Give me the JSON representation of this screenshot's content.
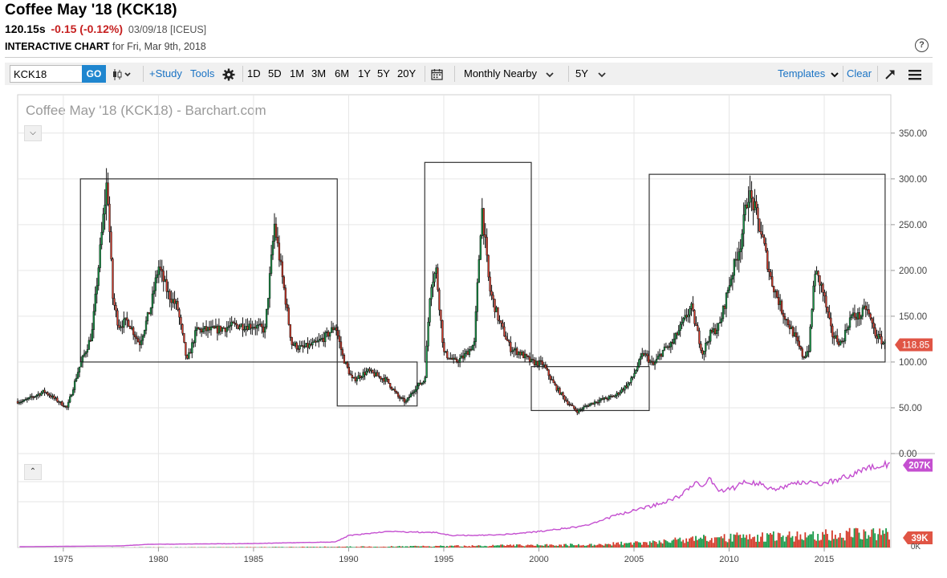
{
  "header": {
    "title": "Coffee May '18 (KCK18)",
    "last": "120.15s",
    "change": "-0.15 (-0.12%)",
    "date_exchange": "03/09/18 [ICEUS]",
    "chart_label": "INTERACTIVE CHART",
    "chart_date": "for Fri, Mar 9th, 2018"
  },
  "toolbar": {
    "symbol_value": "KCK18",
    "go_label": "GO",
    "study_label": "+Study",
    "tools_label": "Tools",
    "periods": [
      "1D",
      "5D",
      "1M",
      "3M",
      "6M",
      "1Y",
      "5Y",
      "20Y"
    ],
    "contract_mode": "Monthly Nearby",
    "range": "5Y",
    "templates_label": "Templates",
    "clear_label": "Clear"
  },
  "icons": {
    "chart_type": "candlestick-icon",
    "settings": "gear-icon",
    "calendar": "calendar-icon",
    "expand": "expand-arrow-icon",
    "menu": "hamburger-menu-icon",
    "help": "help-icon"
  },
  "colors": {
    "up": "#1a9a4a",
    "down": "#d43a2a",
    "open_interest": "#c44fd0",
    "last_price_badge": "#e05545",
    "volume_badge": "#e05545",
    "link": "#1a73c4"
  },
  "chart_data": {
    "type": "candlestick",
    "watermark": "Coffee May '18 (KCK18) - Barchart.com",
    "xlim": [
      1972.6,
      2018.5
    ],
    "ylim": [
      0,
      370
    ],
    "y_ticks": [
      "350.00",
      "300.00",
      "250.00",
      "200.00",
      "150.00",
      "100.00",
      "50.00",
      "0.00"
    ],
    "x_ticks": [
      "1975",
      "1980",
      "1985",
      "1990",
      "1995",
      "2000",
      "2005",
      "2010",
      "2015"
    ],
    "last_price_label": "118.85",
    "series": [
      {
        "name": "price",
        "x": [
          1972.9,
          1974,
          1975.2,
          1975.8,
          1976.5,
          1977.3,
          1977.6,
          1977.9,
          1978.4,
          1979,
          1979.6,
          1980.0,
          1980.5,
          1981,
          1981.5,
          1982,
          1983,
          1984,
          1985,
          1985.6,
          1986.1,
          1986.6,
          1987,
          1987.5,
          1988.3,
          1988.9,
          1989.3,
          1989.7,
          1990.2,
          1991,
          1992,
          1992.6,
          1993,
          1993.5,
          1994,
          1994.3,
          1994.6,
          1995,
          1995.6,
          1996,
          1996.6,
          1997.0,
          1997.4,
          1997.9,
          1998.5,
          1999.0,
          1999.6,
          2000.2,
          2000.8,
          2001.5,
          2002,
          2002.5,
          2003,
          2004,
          2004.8,
          2005.5,
          2006.0,
          2006.5,
          2007,
          2008,
          2008.6,
          2009,
          2009.5,
          2010,
          2010.6,
          2011.0,
          2011.3,
          2011.7,
          2012.2,
          2012.8,
          2013.4,
          2013.9,
          2014.2,
          2014.5,
          2014.9,
          2015.4,
          2015.9,
          2016.4,
          2016.9,
          2017.2,
          2017.7,
          2018.2
        ],
        "y": [
          57,
          68,
          50,
          92,
          130,
          300,
          170,
          140,
          145,
          120,
          160,
          205,
          175,
          160,
          100,
          135,
          135,
          140,
          140,
          135,
          250,
          180,
          120,
          115,
          120,
          130,
          140,
          105,
          80,
          90,
          80,
          62,
          56,
          72,
          80,
          185,
          200,
          110,
          100,
          105,
          120,
          270,
          180,
          145,
          115,
          110,
          100,
          98,
          75,
          56,
          46,
          52,
          57,
          63,
          78,
          110,
          96,
          112,
          120,
          160,
          110,
          130,
          140,
          185,
          230,
          285,
          270,
          240,
          190,
          155,
          130,
          105,
          115,
          200,
          180,
          130,
          120,
          150,
          150,
          160,
          130,
          118.85
        ]
      },
      {
        "name": "open interest",
        "x": [
          1972.7,
          1978,
          1979.5,
          1985,
          1989.3,
          1990,
          1992,
          1994.5,
          1995.5,
          1998,
          2000,
          2002.5,
          2004,
          2006,
          2007.5,
          2008.2,
          2008.7,
          2009,
          2009.5,
          2010.3,
          2010.8,
          2011.6,
          2012.3,
          2013,
          2014,
          2015,
          2016,
          2017,
          2017.6,
          2018.2,
          2018.45
        ],
        "y": [
          2,
          4,
          8,
          10,
          14,
          30,
          40,
          38,
          30,
          32,
          40,
          55,
          80,
          105,
          130,
          165,
          155,
          175,
          140,
          150,
          165,
          160,
          145,
          155,
          165,
          160,
          175,
          195,
          205,
          210,
          207
        ]
      },
      {
        "name": "volume",
        "x": [
          1972.7,
          1985,
          1993,
          2003,
          2006,
          2008,
          2010,
          2012,
          2014,
          2016,
          2018.45
        ],
        "y": [
          0,
          1,
          3,
          8,
          15,
          22,
          28,
          30,
          33,
          36,
          39
        ]
      }
    ],
    "lower_badges": [
      "207K",
      "39K"
    ],
    "lower_axis_label": "0K",
    "range_boxes": [
      {
        "x0": 1975.9,
        "x1": 1989.4,
        "y0": 100,
        "y1": 300
      },
      {
        "x0": 1989.4,
        "x1": 1993.6,
        "y0": 52,
        "y1": 100
      },
      {
        "x0": 1994.0,
        "x1": 1999.6,
        "y0": 100,
        "y1": 318
      },
      {
        "x0": 1999.6,
        "x1": 2005.8,
        "y0": 47,
        "y1": 95
      },
      {
        "x0": 2005.8,
        "x1": 2018.2,
        "y0": 100,
        "y1": 305
      }
    ]
  }
}
